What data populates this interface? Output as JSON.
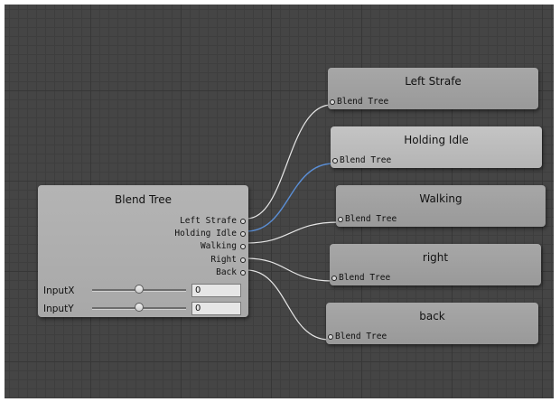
{
  "blend_tree": {
    "title": "Blend Tree",
    "outputs": [
      "Left Strafe",
      "Holding Idle",
      "Walking",
      "Right",
      "Back"
    ],
    "parameters": [
      {
        "label": "InputX",
        "value": "0",
        "slider_fraction": 0.5
      },
      {
        "label": "InputY",
        "value": "0",
        "slider_fraction": 0.5
      }
    ]
  },
  "child_nodes": [
    {
      "title": "Left Strafe",
      "input_label": "Blend Tree"
    },
    {
      "title": "Holding Idle",
      "input_label": "Blend Tree",
      "selected": true
    },
    {
      "title": "Walking",
      "input_label": "Blend Tree"
    },
    {
      "title": "right",
      "input_label": "Blend Tree"
    },
    {
      "title": "back",
      "input_label": "Blend Tree"
    }
  ],
  "colors": {
    "grid_background": "#454545",
    "wire_default": "#e6e6e6",
    "wire_selected": "#5b8fd6"
  }
}
